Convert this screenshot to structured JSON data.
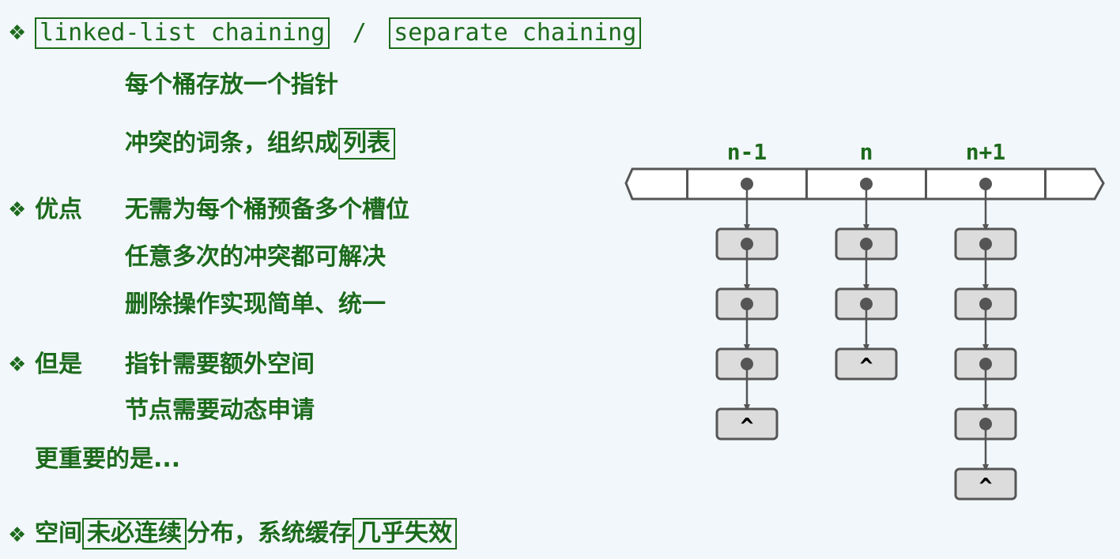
{
  "title_row": {
    "term1": "linked-list chaining",
    "separator": "/",
    "term2": "separate chaining"
  },
  "description": {
    "line1": "每个桶存放一个指针",
    "line2_prefix": "冲突的词条，组织成",
    "line2_boxed": "列表"
  },
  "pros": {
    "label": "优点",
    "items": [
      "无需为每个桶预备多个槽位",
      "任意多次的冲突都可解决",
      "删除操作实现简单、统一"
    ]
  },
  "cons": {
    "label": "但是",
    "items": [
      "指针需要额外空间",
      "节点需要动态申请"
    ],
    "more": "更重要的是..."
  },
  "bottom": {
    "prefix": "空间",
    "boxed1": "未必连续",
    "middle": "分布，系统缓存",
    "boxed2": "几乎失效"
  },
  "diagram": {
    "columns": [
      {
        "label": "n-1",
        "chain_length": 3
      },
      {
        "label": "n",
        "chain_length": 2
      },
      {
        "label": "n+1",
        "chain_length": 4
      }
    ],
    "null_marker": "^"
  },
  "colors": {
    "text": "#1c6a1c",
    "node_fill": "#dcdcdc",
    "node_stroke": "#555555"
  }
}
